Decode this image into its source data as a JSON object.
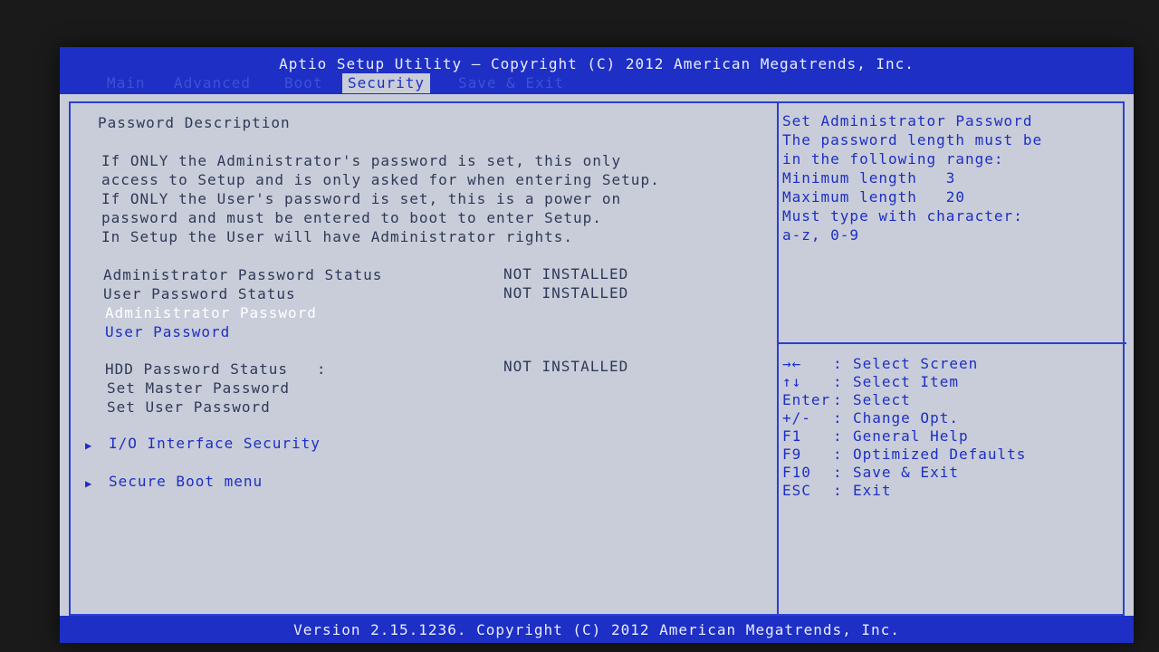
{
  "header": {
    "title": "Aptio Setup Utility – Copyright (C) 2012 American Megatrends, Inc.",
    "tabs": [
      "Main",
      "Advanced",
      "Boot",
      "Security",
      "Save & Exit"
    ],
    "active_tab": "Security"
  },
  "main": {
    "section_title": "Password Description",
    "description_lines": [
      "If ONLY the Administrator's password is set, this only",
      "access to Setup and is only asked for when entering Setup.",
      "If ONLY the User's password is set, this is a power on",
      "password and must be entered to boot to enter Setup.",
      "In Setup the User will have Administrator rights."
    ],
    "admin_status_label": "Administrator Password Status",
    "admin_status_value": "NOT INSTALLED",
    "user_status_label": "User Password Status",
    "user_status_value": "NOT INSTALLED",
    "admin_password": "Administrator Password",
    "user_password": "User Password",
    "hdd_status_label": "HDD Password Status   :",
    "hdd_status_value": "NOT INSTALLED",
    "set_master_password": "Set Master Password",
    "set_user_password": "Set User Password",
    "io_security": "I/O Interface Security",
    "secure_boot": "Secure Boot menu",
    "submenu_marker": "▶"
  },
  "help": {
    "lines": [
      "Set Administrator Password",
      "The password length must be",
      "in the following range:",
      "Minimum length   3",
      "Maximum length   20",
      "Must type with character:",
      "a-z, 0-9"
    ]
  },
  "keys": [
    {
      "key": "→←",
      "sep": ":",
      "action": "Select Screen"
    },
    {
      "key": "↑↓",
      "sep": ":",
      "action": "Select Item"
    },
    {
      "key": "Enter",
      "sep": ":",
      "action": "Select"
    },
    {
      "key": "+/-",
      "sep": ":",
      "action": "Change Opt."
    },
    {
      "key": "F1",
      "sep": ":",
      "action": "General Help"
    },
    {
      "key": "F9",
      "sep": ":",
      "action": "Optimized Defaults"
    },
    {
      "key": "F10",
      "sep": ":",
      "action": "Save & Exit"
    },
    {
      "key": "ESC",
      "sep": ":",
      "action": "Exit"
    }
  ],
  "footer": {
    "version": "Version 2.15.1236. Copyright (C) 2012 American Megatrends, Inc."
  },
  "colors": {
    "bar_blue": "#1d2fc4",
    "panel_bg": "#c9cdd9",
    "text": "#2f3a58",
    "selected": "#ffffff"
  }
}
